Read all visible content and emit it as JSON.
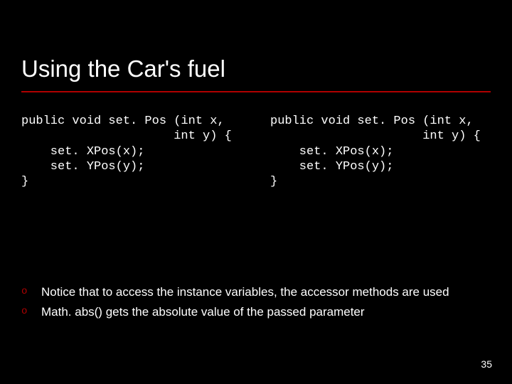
{
  "title": "Using the Car's fuel",
  "code_left": "public void set. Pos (int x,\n                     int y) {\n    set. XPos(x);\n    set. YPos(y);\n}",
  "code_right": "public void set. Pos (int x,\n                     int y) {\n    set. XPos(x);\n    set. YPos(y);\n}",
  "bullets": [
    "Notice that to access the instance variables, the accessor methods are used",
    "Math. abs() gets the absolute value of the passed parameter"
  ],
  "bullet_mark": "o",
  "page_number": "35"
}
